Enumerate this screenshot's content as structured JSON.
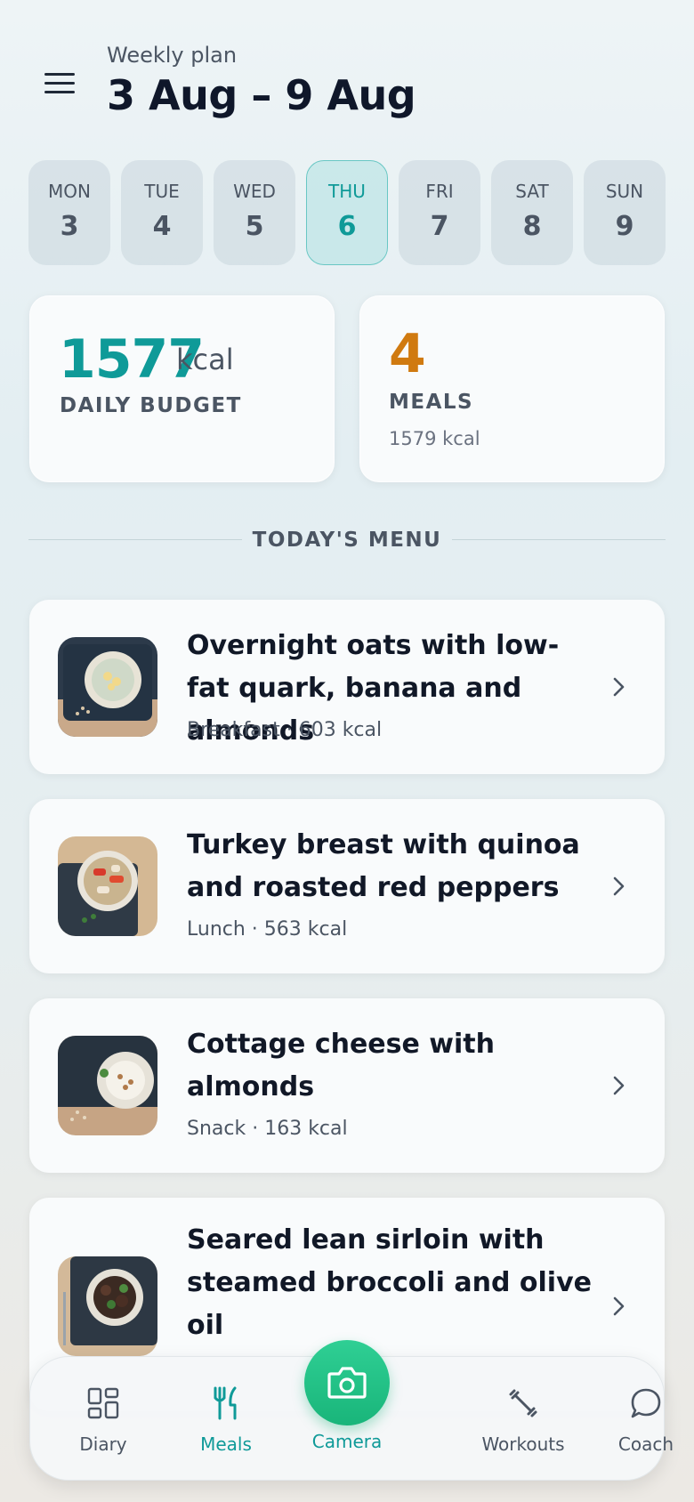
{
  "header": {
    "subtitle": "Weekly plan",
    "title": "3 Aug – 9 Aug"
  },
  "days": [
    {
      "name": "MON",
      "num": "3",
      "active": false
    },
    {
      "name": "TUE",
      "num": "4",
      "active": false
    },
    {
      "name": "WED",
      "num": "5",
      "active": false
    },
    {
      "name": "THU",
      "num": "6",
      "active": true
    },
    {
      "name": "FRI",
      "num": "7",
      "active": false
    },
    {
      "name": "SAT",
      "num": "8",
      "active": false
    },
    {
      "name": "SUN",
      "num": "9",
      "active": false
    }
  ],
  "stats": {
    "budget_value": "1577",
    "budget_unit": "kcal",
    "budget_label": "DAILY BUDGET",
    "meals_count": "4",
    "meals_label": "MEALS",
    "meals_kcal": "1579 kcal"
  },
  "section_title": "TODAY'S MENU",
  "meals": [
    {
      "name": "Overnight oats with low-fat quark, banana and almonds",
      "sub": "Breakfast · 603 kcal"
    },
    {
      "name": "Turkey breast with quinoa and roasted red peppers",
      "sub": "Lunch · 563 kcal"
    },
    {
      "name": "Cottage cheese with almonds",
      "sub": "Snack · 163 kcal"
    },
    {
      "name": "Seared lean sirloin with steamed broccoli and olive oil",
      "sub": ""
    }
  ],
  "nav": {
    "diary": "Diary",
    "meals": "Meals",
    "camera": "Camera",
    "workouts": "Workouts",
    "coach": "Coach"
  },
  "colors": {
    "accent": "#0f9a98",
    "meals_orange": "#d07a10",
    "camera_green": "#19b57a"
  }
}
